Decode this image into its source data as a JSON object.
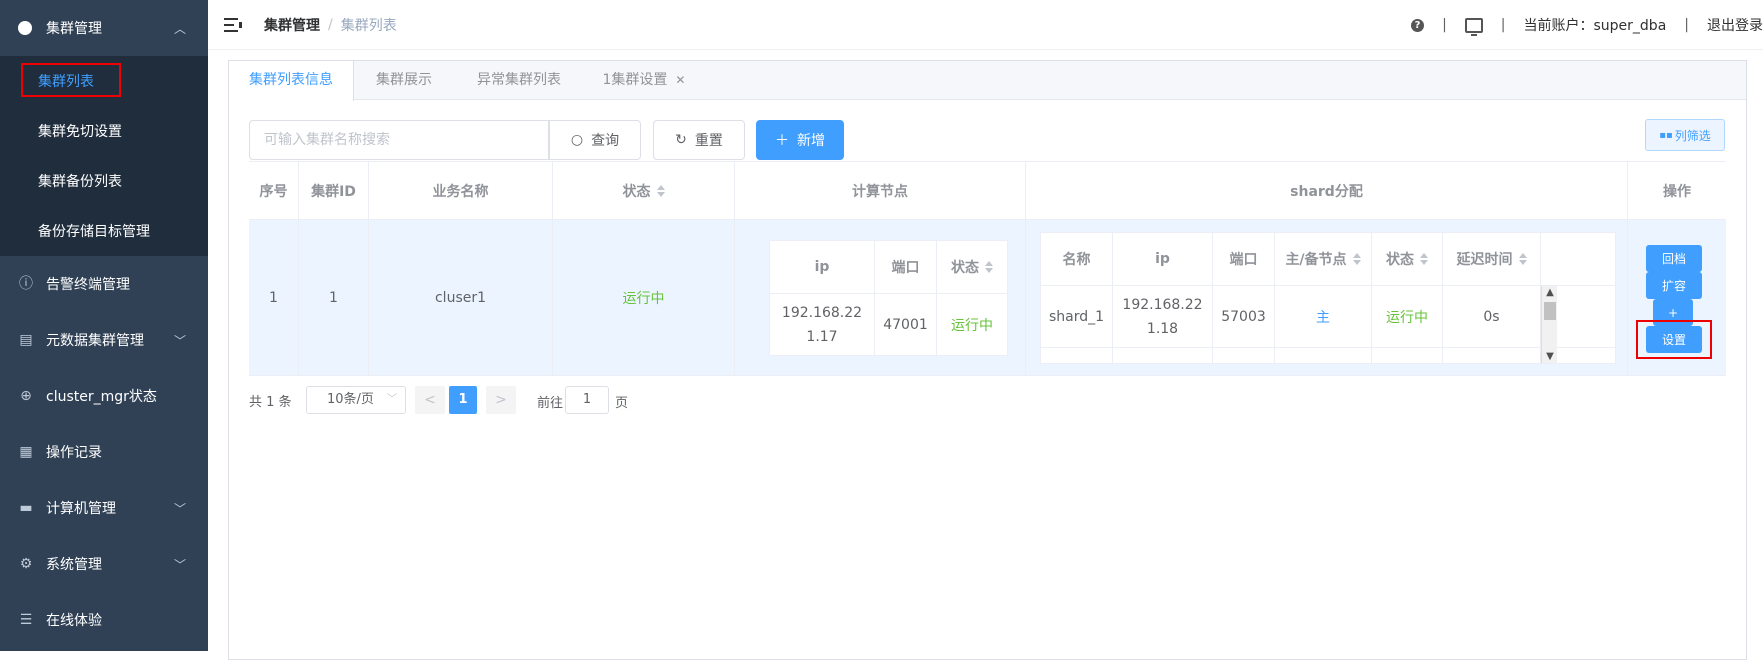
{
  "sidebar": {
    "group_label": "集群管理",
    "sub_items": [
      "集群列表",
      "集群免切设置",
      "集群备份列表",
      "备份存储目标管理"
    ],
    "items": [
      {
        "label": "告警终端管理",
        "icon": "info-circle-icon",
        "has_arrow": false
      },
      {
        "label": "元数据集群管理",
        "icon": "dashboard-icon",
        "has_arrow": true
      },
      {
        "label": "cluster_mgr状态",
        "icon": "globe-icon",
        "has_arrow": false
      },
      {
        "label": "操作记录",
        "icon": "document-icon",
        "has_arrow": false
      },
      {
        "label": "计算机管理",
        "icon": "monitor-icon",
        "has_arrow": true
      },
      {
        "label": "系统管理",
        "icon": "gear-icon",
        "has_arrow": true
      },
      {
        "label": "在线体验",
        "icon": "database-icon",
        "has_arrow": false
      }
    ]
  },
  "header": {
    "breadcrumb_1": "集群管理",
    "breadcrumb_sep": "/",
    "breadcrumb_2": "集群列表",
    "sep": "|",
    "account": "当前账户：super_dba",
    "logout": "退出登录"
  },
  "tabs": [
    {
      "label": "集群列表信息",
      "active": true,
      "closable": false
    },
    {
      "label": "集群展示",
      "active": false,
      "closable": false
    },
    {
      "label": "异常集群列表",
      "active": false,
      "closable": false
    },
    {
      "label": "1集群设置",
      "active": false,
      "closable": true
    }
  ],
  "toolbar": {
    "search_placeholder": "可输入集群名称搜索",
    "query_label": "查询",
    "reset_label": "重置",
    "add_label": "新增",
    "col_filter_label": "列筛选"
  },
  "table": {
    "headers": [
      "序号",
      "集群ID",
      "业务名称",
      "状态",
      "计算节点",
      "shard分配",
      "操作"
    ],
    "row": {
      "index": "1",
      "cluster_id": "1",
      "name": "cluser1",
      "status": "运行中",
      "compute": {
        "headers": [
          "ip",
          "端口",
          "状态"
        ],
        "row": {
          "ip": "192.168.221.17",
          "port": "47001",
          "status": "运行中"
        }
      },
      "shard": {
        "headers": [
          "名称",
          "ip",
          "端口",
          "主/备节点",
          "状态",
          "延迟时间"
        ],
        "row": {
          "name": "shard_1",
          "ip": "192.168.221.18",
          "port": "57003",
          "role": "主",
          "status": "运行中",
          "delay": "0s"
        }
      },
      "actions": [
        "回档",
        "扩容",
        "+",
        "设置"
      ]
    }
  },
  "pagination": {
    "total": "共 1 条",
    "page_size": "10条/页",
    "prev": "<",
    "current": "1",
    "next": ">",
    "goto_label": "前往",
    "goto_value": "1",
    "page_unit": "页"
  },
  "colors": {
    "primary": "#409eff",
    "sidebar": "#304156",
    "success": "#67c23a",
    "highlight": "#e00000"
  }
}
